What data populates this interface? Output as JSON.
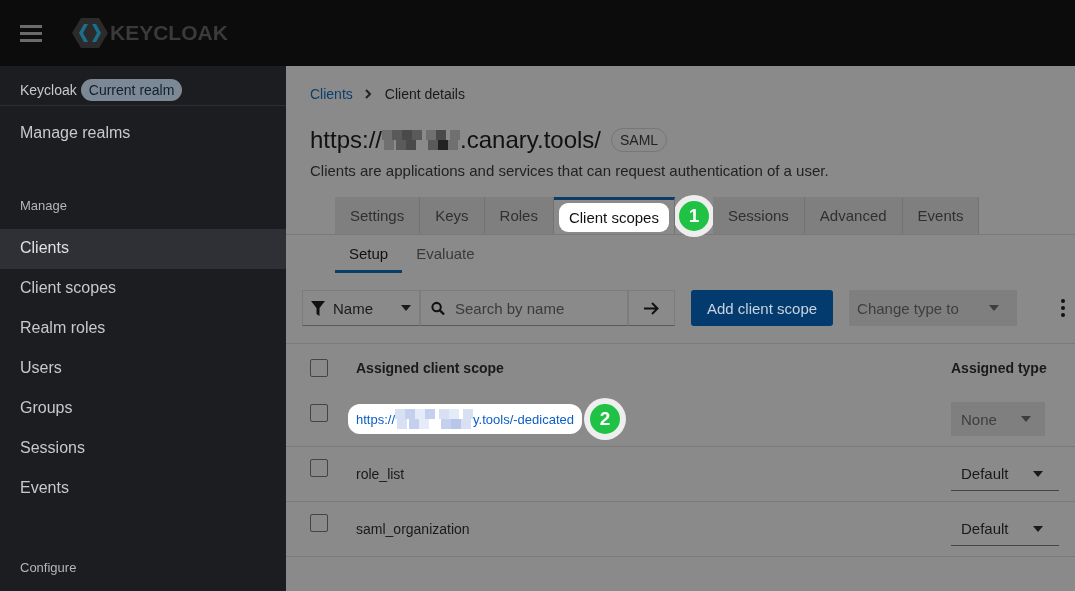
{
  "header": {
    "brand": "KEYCLOAK"
  },
  "sidebar": {
    "realm": "Keycloak",
    "realm_badge": "Current realm",
    "manage_realms": "Manage realms",
    "sections": [
      {
        "title": "Manage",
        "items": [
          {
            "label": "Clients",
            "selected": true
          },
          {
            "label": "Client scopes",
            "selected": false
          },
          {
            "label": "Realm roles",
            "selected": false
          },
          {
            "label": "Users",
            "selected": false
          },
          {
            "label": "Groups",
            "selected": false
          },
          {
            "label": "Sessions",
            "selected": false
          },
          {
            "label": "Events",
            "selected": false
          }
        ]
      },
      {
        "title": "Configure"
      }
    ]
  },
  "breadcrumb": [
    {
      "label": "Clients",
      "kind": "link"
    },
    {
      "label": "Client details",
      "kind": "current"
    }
  ],
  "title": {
    "prefix": "https://",
    "suffix": ".canary.tools/",
    "badge": "SAML"
  },
  "description": "Clients are applications and services that can request authentication of a user.",
  "tabs": [
    {
      "label": "Settings",
      "selected": false
    },
    {
      "label": "Keys",
      "selected": false
    },
    {
      "label": "Roles",
      "selected": false
    },
    {
      "label": "Client scopes",
      "selected": true,
      "callout": "1"
    },
    {
      "label": "Sessions",
      "selected": false
    },
    {
      "label": "Advanced",
      "selected": false
    },
    {
      "label": "Events",
      "selected": false
    }
  ],
  "subtabs": [
    {
      "label": "Setup",
      "selected": true
    },
    {
      "label": "Evaluate",
      "selected": false
    }
  ],
  "toolbar": {
    "filter": "Name",
    "search_placeholder": "Search by name",
    "add_button": "Add client scope",
    "change_type": "Change type to"
  },
  "table": {
    "select_all_checked": false,
    "columns": [
      "Assigned client scope",
      "Assigned type"
    ],
    "rows": [
      {
        "kind": "link",
        "prefix": "https://",
        "suffix": "y.tools/-dedicated",
        "callout": "2",
        "type": "None",
        "type_disabled": true,
        "checked": false
      },
      {
        "kind": "text",
        "name": "role_list",
        "type": "Default",
        "type_disabled": false,
        "checked": false
      },
      {
        "kind": "text",
        "name": "saml_organization",
        "type": "Default",
        "type_disabled": false,
        "checked": false
      }
    ]
  }
}
